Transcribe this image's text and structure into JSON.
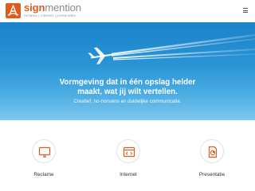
{
  "header": {
    "brand_part1": "sign",
    "brand_part2": "mention",
    "tagline": "reclame | internet | presentatie",
    "colors": {
      "accent": "#e05a1c",
      "grey": "#8a8a8a"
    }
  },
  "hero": {
    "title_line1": "Vormgeving dat in één opslag helder",
    "title_line2": "maakt, wat jij wilt vertellen.",
    "subtitle": "Creatief, no-nonsens en duidelijke communicatie.",
    "colors": {
      "sky_top": "#1b82c9",
      "sky_bottom": "#7ec8ee"
    }
  },
  "services": [
    {
      "label": "Reclame",
      "icon": "monitor-icon"
    },
    {
      "label": "Internet",
      "icon": "browser-code-icon"
    },
    {
      "label": "Presentatie",
      "icon": "document-chart-icon"
    }
  ]
}
